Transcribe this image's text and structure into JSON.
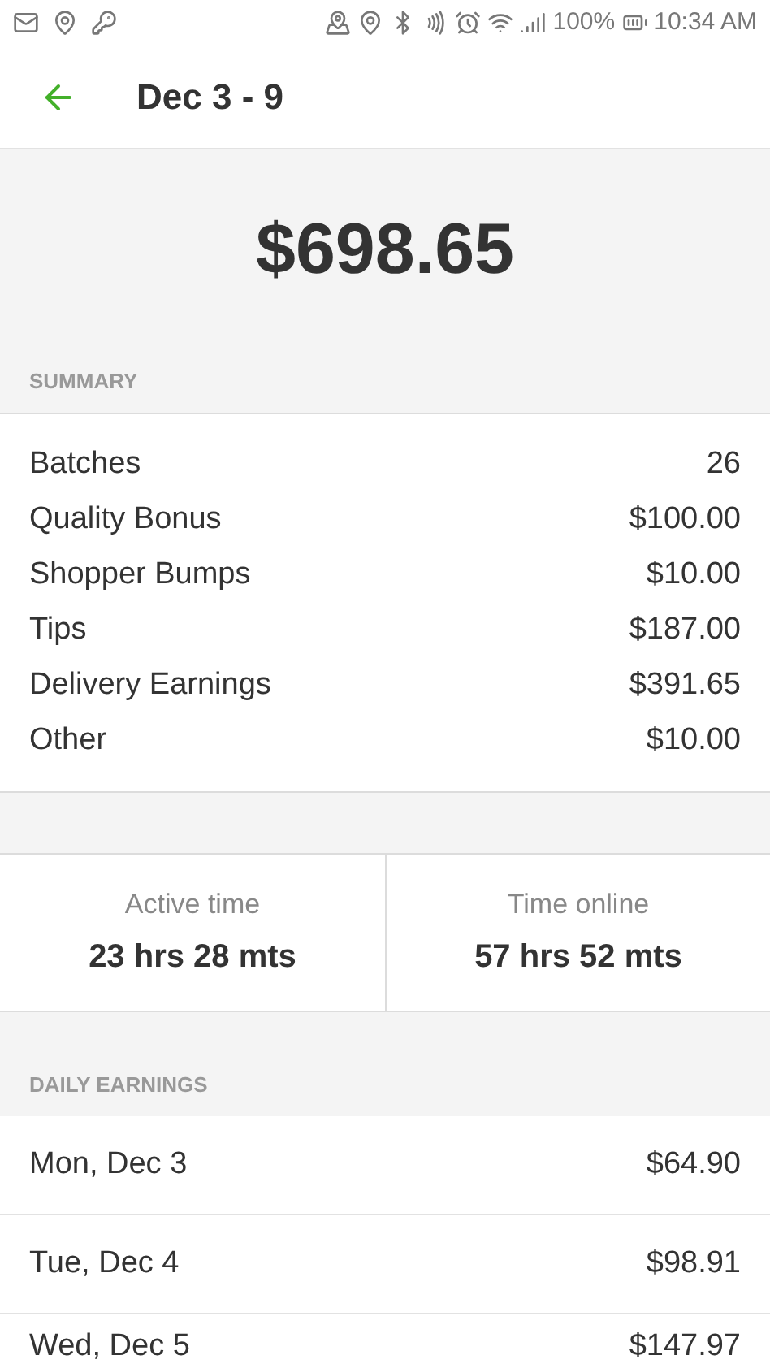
{
  "status_bar": {
    "battery": "100%",
    "time": "10:34 AM"
  },
  "header": {
    "title": "Dec 3 - 9"
  },
  "total": "$698.65",
  "summary": {
    "label": "SUMMARY",
    "rows": [
      {
        "label": "Batches",
        "value": "26"
      },
      {
        "label": "Quality Bonus",
        "value": "$100.00"
      },
      {
        "label": "Shopper Bumps",
        "value": "$10.00"
      },
      {
        "label": "Tips",
        "value": "$187.00"
      },
      {
        "label": "Delivery Earnings",
        "value": "$391.65"
      },
      {
        "label": "Other",
        "value": "$10.00"
      }
    ]
  },
  "times": [
    {
      "label": "Active time",
      "value": "23 hrs 28 mts"
    },
    {
      "label": "Time online",
      "value": "57 hrs 52 mts"
    }
  ],
  "daily": {
    "label": "DAILY EARNINGS",
    "rows": [
      {
        "day": "Mon, Dec 3",
        "amount": "$64.90"
      },
      {
        "day": "Tue, Dec 4",
        "amount": "$98.91"
      },
      {
        "day": "Wed, Dec 5",
        "amount": "$147.97"
      }
    ]
  }
}
